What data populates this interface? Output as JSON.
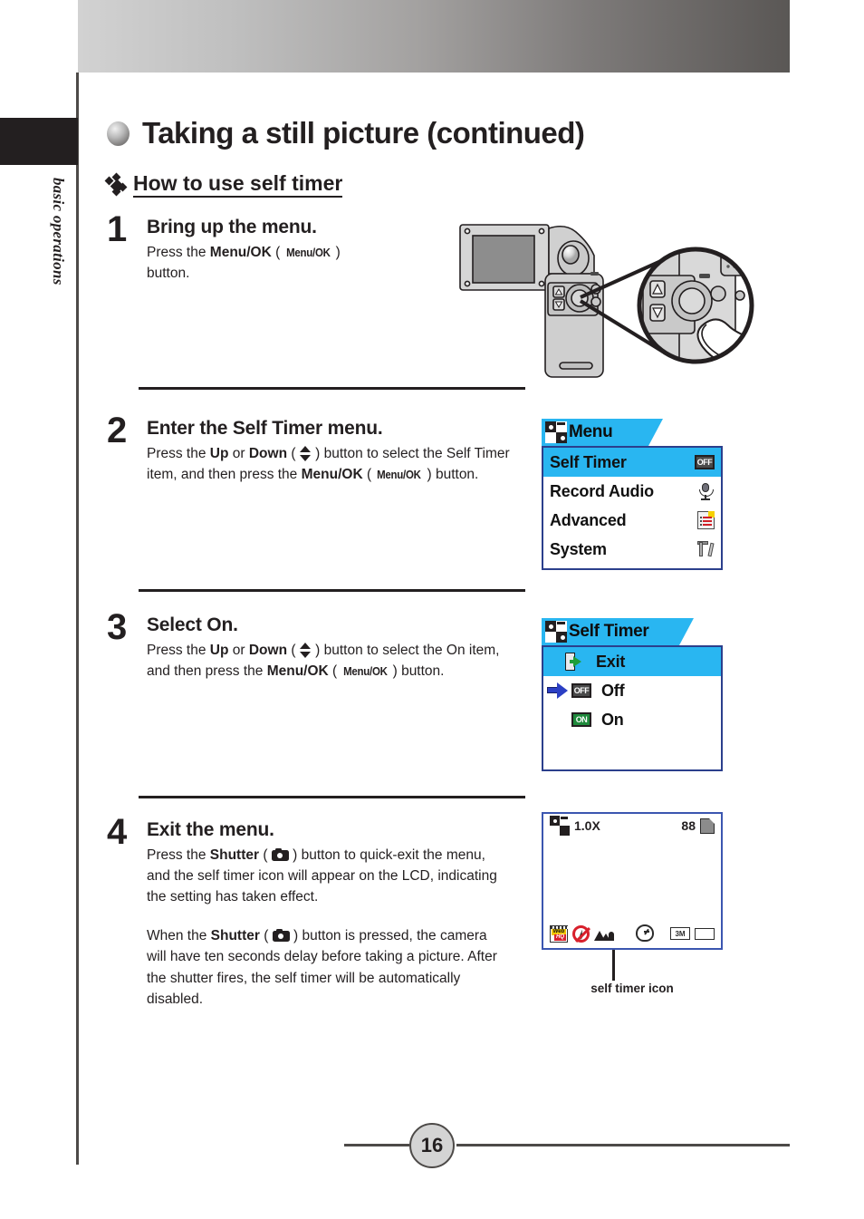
{
  "sidebar": {
    "section_label": "basic operations"
  },
  "header": {
    "title": "Taking a still picture (continued)",
    "section_heading": "How to use self timer"
  },
  "steps": [
    {
      "number": "1",
      "heading": "Bring up the menu.",
      "text_pre": "Press the ",
      "bold1": "Menu/OK",
      "paren_badge": "Menu/OK",
      "text_post": "button."
    },
    {
      "number": "2",
      "heading": "Enter the Self Timer menu.",
      "t1": "Press the ",
      "b1": "Up",
      "t2": " or ",
      "b2": "Down",
      "t3": " ( ",
      "t4": " ) button to select the Self Timer item, and then press the ",
      "b3": "Menu/OK",
      "t5": " ( ",
      "badge": "Menu/OK",
      "t6": " ) button."
    },
    {
      "number": "3",
      "heading": "Select On.",
      "t1": "Press the ",
      "b1": "Up",
      "t2": " or ",
      "b2": "Down",
      "t3": " ( ",
      "t4": " ) button to select the On item, and then press the ",
      "b3": "Menu/OK",
      "t5": " ( ",
      "badge": "Menu/OK",
      "t6": " ) button."
    },
    {
      "number": "4",
      "heading": "Exit the menu.",
      "p1_a": "Press the ",
      "p1_b": "Shutter",
      "p1_c": " ( ",
      "p1_d": " ) button to quick-exit the menu, and the self timer icon will appear on the LCD, indicating the setting has taken effect.",
      "p2_a": "When the ",
      "p2_b": "Shutter",
      "p2_c": " ( ",
      "p2_d": " ) button is pressed, the camera will have ten seconds delay before taking a picture. After the shutter fires, the self timer will be automatically disabled."
    }
  ],
  "menu_screen": {
    "tab_title": "Menu",
    "items": [
      {
        "label": "Self Timer",
        "icon": "off-badge-icon",
        "selected": true
      },
      {
        "label": "Record Audio",
        "icon": "microphone-icon",
        "selected": false
      },
      {
        "label": "Advanced",
        "icon": "list-page-icon",
        "selected": false
      },
      {
        "label": "System",
        "icon": "tools-icon",
        "selected": false
      }
    ]
  },
  "self_timer_screen": {
    "tab_title": "Self Timer",
    "items": [
      {
        "label": "Exit",
        "icon": "exit-door-icon",
        "selected": true,
        "cursor": false
      },
      {
        "label": "Off",
        "icon": "off-badge-icon",
        "selected": false,
        "cursor": true
      },
      {
        "label": "On",
        "icon": "on-badge-icon",
        "selected": false,
        "cursor": false
      }
    ]
  },
  "lcd_preview": {
    "zoom": "1.0X",
    "shots_remaining": "88",
    "status_icons": [
      "web-hq-icon",
      "no-flash-icon",
      "scene-mode-icon",
      "self-timer-icon",
      "3M-resolution-icon",
      "battery-icon"
    ],
    "resolution_badge": "3M",
    "caption": "self timer icon"
  },
  "footer": {
    "page_number": "16"
  },
  "colors": {
    "lcd_accent": "#29b6f1",
    "lcd_border": "#2b3f8c",
    "cursor_blue": "#2b3fc4",
    "on_green": "#1f8a3c",
    "ink": "#231f20"
  }
}
